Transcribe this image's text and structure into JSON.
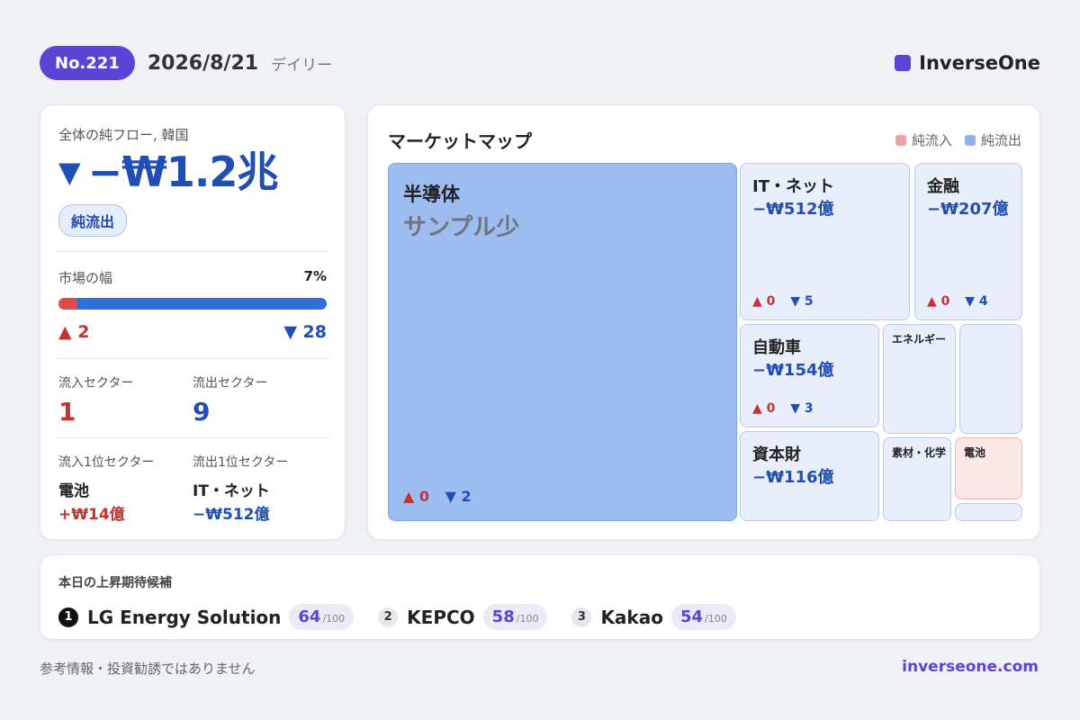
{
  "header": {
    "issue": "No.221",
    "date": "2026/8/21",
    "frequency": "デイリー",
    "brand": "InverseOne",
    "brand_color": "#5b43d6"
  },
  "summary": {
    "label": "全体の純フロー, 韓国",
    "arrow": "▼",
    "value": "−₩1.2兆",
    "badge": "純流出",
    "breadth_label": "市場の幅",
    "breadth_pct": "7%",
    "breadth_fraction": 0.07,
    "adv_up": "▲ 2",
    "adv_down": "▼ 28",
    "inflow_sectors_label": "流入セクター",
    "inflow_sectors": "1",
    "outflow_sectors_label": "流出セクター",
    "outflow_sectors": "9",
    "top_inflow_label": "流入1位セクター",
    "top_inflow_name": "電池",
    "top_inflow_amt": "+₩14億",
    "top_outflow_label": "流出1位セクター",
    "top_outflow_name": "IT・ネット",
    "top_outflow_amt": "−₩512億"
  },
  "market_map": {
    "title": "マーケットマップ",
    "legend_in": "純流入",
    "legend_out": "純流出",
    "legend_in_color": "#f0a2a0",
    "legend_out_color": "#8fb2ec",
    "tiles": [
      {
        "name": "半導体",
        "amount": "サンプル少",
        "up": "▲ 0",
        "down": "▼ 2"
      },
      {
        "name": "IT・ネット",
        "amount": "−₩512億",
        "up": "▲ 0",
        "down": "▼ 5"
      },
      {
        "name": "金融",
        "amount": "−₩207億",
        "up": "▲ 0",
        "down": "▼ 4"
      },
      {
        "name": "自動車",
        "amount": "−₩154億",
        "up": "▲ 0",
        "down": "▼ 3"
      },
      {
        "name": "エネルギー"
      },
      {
        "name": "資本財",
        "amount": "−₩116億"
      },
      {
        "name": "素材・化学"
      },
      {
        "name": "電池"
      }
    ]
  },
  "candidates": {
    "title": "本日の上昇期待候補",
    "items": [
      {
        "rank": "1",
        "name": "LG Energy Solution",
        "score": "64",
        "max": "/100"
      },
      {
        "rank": "2",
        "name": "KEPCO",
        "score": "58",
        "max": "/100"
      },
      {
        "rank": "3",
        "name": "Kakao",
        "score": "54",
        "max": "/100"
      }
    ]
  },
  "footer": {
    "disclaimer": "参考情報・投資勧誘ではありません",
    "site": "inverseone.com"
  }
}
